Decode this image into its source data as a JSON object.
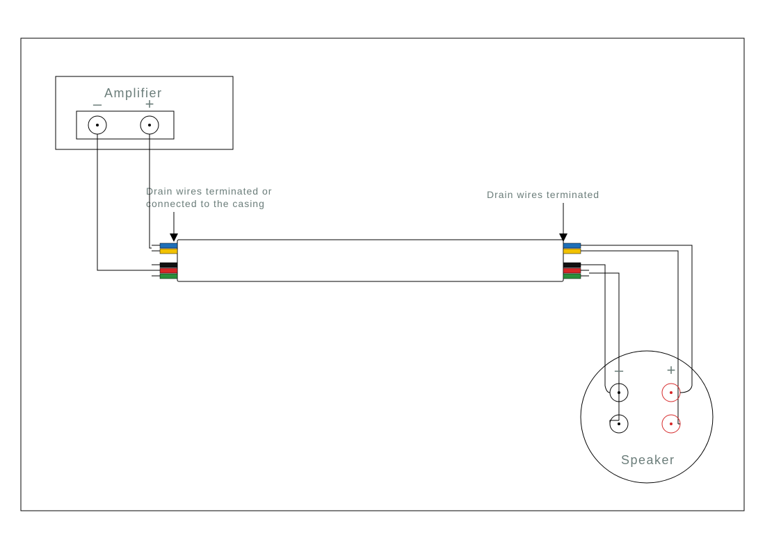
{
  "amplifier": {
    "label": "Amplifier",
    "terminals": {
      "minus": "–",
      "plus": "+"
    }
  },
  "labels": {
    "drain_left_line1": "Drain wires terminated or",
    "drain_left_line2": "connected to the casing",
    "drain_right": "Drain wires terminated"
  },
  "speaker": {
    "label": "Speaker",
    "terminals": {
      "minus": "–",
      "plus": "+"
    }
  },
  "cable": {
    "conductors": [
      {
        "name": "blue",
        "color": "#1e6fb8"
      },
      {
        "name": "yellow",
        "color": "#f2c200"
      },
      {
        "name": "black",
        "color": "#111111"
      },
      {
        "name": "red",
        "color": "#d62728"
      },
      {
        "name": "green",
        "color": "#2a8f3c"
      }
    ]
  },
  "colors": {
    "text": "#6b7d7a",
    "outline": "#000000",
    "speaker_pos": "#d62728"
  }
}
